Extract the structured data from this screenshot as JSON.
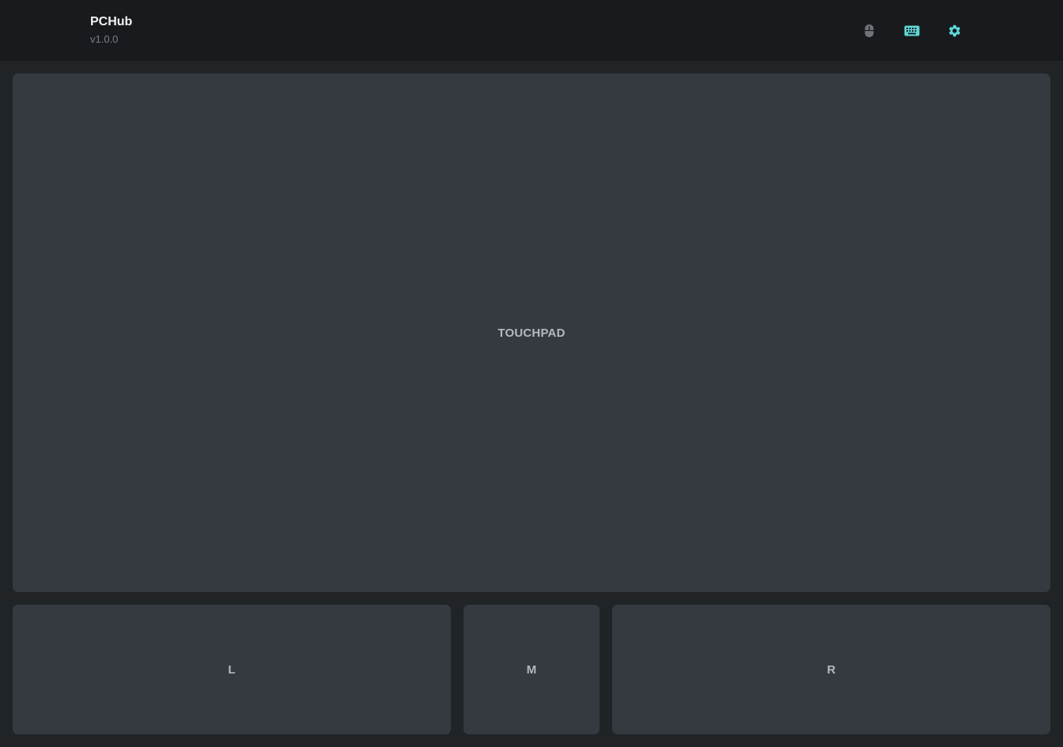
{
  "header": {
    "title": "PCHub",
    "version": "v1.0.0"
  },
  "modes": [
    {
      "name": "mouse",
      "icon": "mouse-icon",
      "active": false
    },
    {
      "name": "keyboard",
      "icon": "keyboard-icon",
      "active": true
    },
    {
      "name": "settings",
      "icon": "gear-icon",
      "active": true
    }
  ],
  "colors": {
    "background": "#202427",
    "header_bg": "#181a1d",
    "panel_bg": "#353a41",
    "accent": "#5fd8d8",
    "icon_inactive": "#6f747a",
    "label_text": "#b4b9bf"
  },
  "touchpad": {
    "label": "TOUCHPAD"
  },
  "buttons": {
    "left": "L",
    "middle": "M",
    "right": "R"
  }
}
